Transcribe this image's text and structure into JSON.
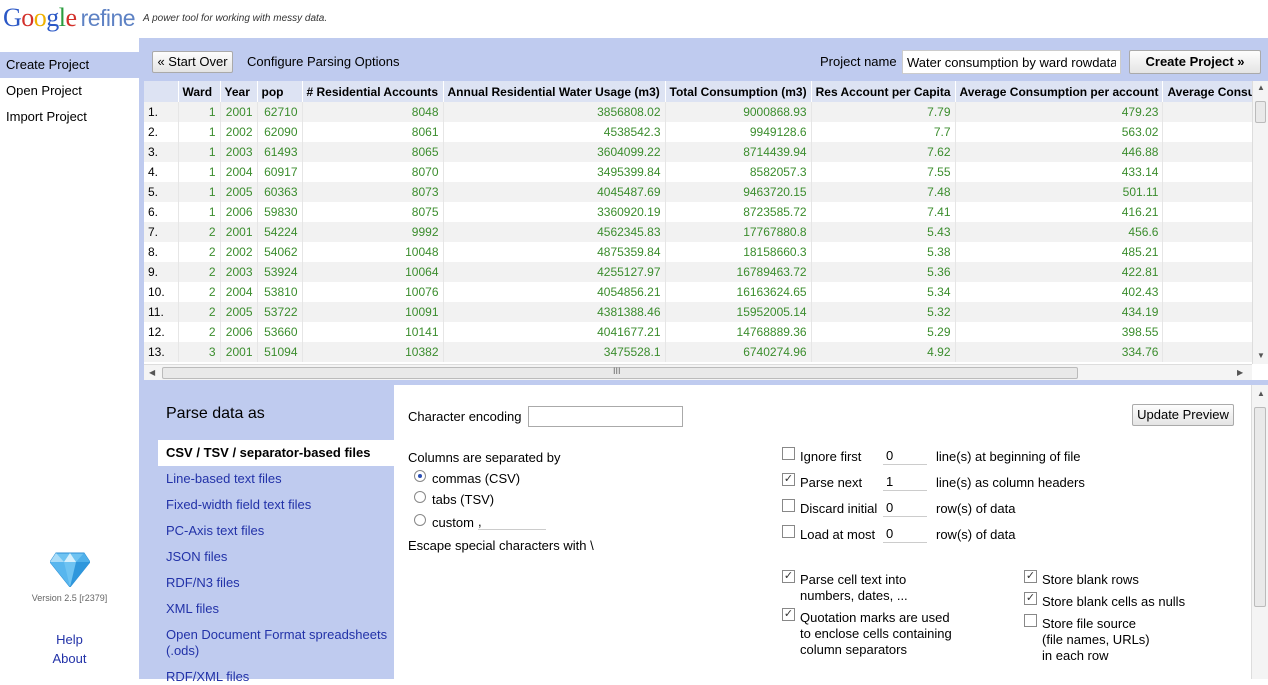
{
  "header": {
    "tagline": "A power tool for working with messy data.",
    "logo_text": "Google refine"
  },
  "nav": {
    "items": [
      {
        "label": "Create Project",
        "selected": true
      },
      {
        "label": "Open Project",
        "selected": false
      },
      {
        "label": "Import Project",
        "selected": false
      }
    ],
    "version": "Version 2.5 [r2379]",
    "help": "Help",
    "about": "About"
  },
  "toolbar": {
    "start_over": "« Start Over",
    "title": "Configure Parsing Options",
    "project_name_label": "Project name",
    "project_name_value": "Water consumption by ward rowdata",
    "create_project": "Create Project »"
  },
  "grid": {
    "columns": [
      "",
      "Ward",
      "Year",
      "pop",
      "# Residential Accounts",
      "Annual Residential Water Usage (m3)",
      "Total Consumption (m3)",
      "Res Account per Capita",
      "Average Consumption per account",
      "Average Consu"
    ],
    "rows": [
      [
        "1.",
        "1",
        "2001",
        "62710",
        "8048",
        "3856808.02",
        "9000868.93",
        "7.79",
        "479.23"
      ],
      [
        "2.",
        "1",
        "2002",
        "62090",
        "8061",
        "4538542.3",
        "9949128.6",
        "7.7",
        "563.02"
      ],
      [
        "3.",
        "1",
        "2003",
        "61493",
        "8065",
        "3604099.22",
        "8714439.94",
        "7.62",
        "446.88"
      ],
      [
        "4.",
        "1",
        "2004",
        "60917",
        "8070",
        "3495399.84",
        "8582057.3",
        "7.55",
        "433.14"
      ],
      [
        "5.",
        "1",
        "2005",
        "60363",
        "8073",
        "4045487.69",
        "9463720.15",
        "7.48",
        "501.11"
      ],
      [
        "6.",
        "1",
        "2006",
        "59830",
        "8075",
        "3360920.19",
        "8723585.72",
        "7.41",
        "416.21"
      ],
      [
        "7.",
        "2",
        "2001",
        "54224",
        "9992",
        "4562345.83",
        "17767880.8",
        "5.43",
        "456.6"
      ],
      [
        "8.",
        "2",
        "2002",
        "54062",
        "10048",
        "4875359.84",
        "18158660.3",
        "5.38",
        "485.21"
      ],
      [
        "9.",
        "2",
        "2003",
        "53924",
        "10064",
        "4255127.97",
        "16789463.72",
        "5.36",
        "422.81"
      ],
      [
        "10.",
        "2",
        "2004",
        "53810",
        "10076",
        "4054856.21",
        "16163624.65",
        "5.34",
        "402.43"
      ],
      [
        "11.",
        "2",
        "2005",
        "53722",
        "10091",
        "4381388.46",
        "15952005.14",
        "5.32",
        "434.19"
      ],
      [
        "12.",
        "2",
        "2006",
        "53660",
        "10141",
        "4041677.21",
        "14768889.36",
        "5.29",
        "398.55"
      ],
      [
        "13.",
        "3",
        "2001",
        "51094",
        "10382",
        "3475528.1",
        "6740274.96",
        "4.92",
        "334.76"
      ]
    ],
    "hscroll_marker": "III"
  },
  "formats": {
    "title": "Parse data as",
    "items": [
      "CSV / TSV / separator-based files",
      "Line-based text files",
      "Fixed-width field text files",
      "PC-Axis text files",
      "JSON files",
      "RDF/N3 files",
      "XML files",
      "Open Document Format spreadsheets (.ods)",
      "RDF/XML files"
    ]
  },
  "options": {
    "encoding_label": "Character encoding",
    "encoding_value": "",
    "update_preview": "Update Preview",
    "separator_label": "Columns are separated by",
    "sep_commas": "commas (CSV)",
    "sep_tabs": "tabs (TSV)",
    "sep_custom": "custom",
    "custom_value": ",",
    "escape_label": "Escape special characters with \\",
    "ignore_first": "Ignore first",
    "ignore_value": "0",
    "ignore_suffix": "line(s) at beginning of file",
    "parse_next": "Parse next",
    "parse_value": "1",
    "parse_suffix": "line(s) as column headers",
    "discard_initial": "Discard initial",
    "discard_value": "0",
    "discard_suffix": "row(s) of data",
    "load_at_most": "Load at most",
    "load_value": "0",
    "load_suffix": "row(s) of data",
    "parse_cell_1": "Parse cell text into",
    "parse_cell_2": "numbers, dates, ...",
    "quote_1": "Quotation marks are used",
    "quote_2": "to enclose cells containing",
    "quote_3": "column separators",
    "store_blank_rows": "Store blank rows",
    "store_blank_cells": "Store blank cells as nulls",
    "store_source_1": "Store file source",
    "store_source_2": "(file names, URLs)",
    "store_source_3": "in each row"
  }
}
